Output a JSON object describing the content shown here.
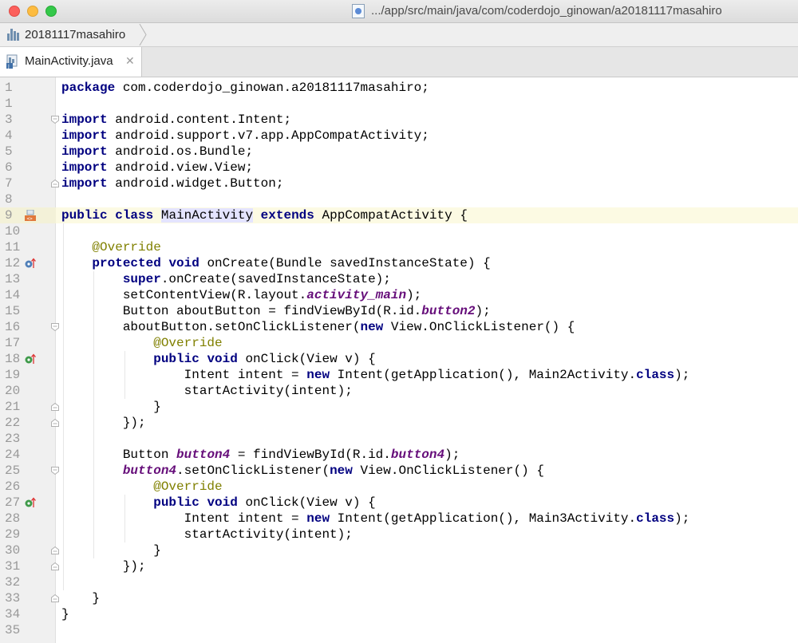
{
  "window": {
    "title_path": ".../app/src/main/java/com/coderdojo_ginowan/a20181117masahiro",
    "controls": {
      "close_color": "#fc605c",
      "minimize_color": "#fdbc40",
      "maximize_color": "#34c84a"
    }
  },
  "navbar": {
    "project": "20181117masahiro"
  },
  "tabs": [
    {
      "label": "MainActivity.java",
      "close": "✕",
      "active": true
    }
  ],
  "editor": {
    "highlight_line": 9,
    "colors": {
      "keyword": "#000080",
      "annotation": "#808000",
      "static_field": "#660e7a",
      "highlight": "#fcfae3"
    },
    "lines": [
      {
        "n": "1",
        "code": "package com.coderdojo_ginowan.a20181117masahiro;"
      },
      {
        "n": "1",
        "code": ""
      },
      {
        "n": "3",
        "code": "import android.content.Intent;"
      },
      {
        "n": "4",
        "code": "import android.support.v7.app.AppCompatActivity;"
      },
      {
        "n": "5",
        "code": "import android.os.Bundle;"
      },
      {
        "n": "6",
        "code": "import android.view.View;"
      },
      {
        "n": "7",
        "code": "import android.widget.Button;"
      },
      {
        "n": "8",
        "code": ""
      },
      {
        "n": "9",
        "code": "public class MainActivity extends AppCompatActivity {"
      },
      {
        "n": "10",
        "code": ""
      },
      {
        "n": "11",
        "code": "    @Override"
      },
      {
        "n": "12",
        "code": "    protected void onCreate(Bundle savedInstanceState) {"
      },
      {
        "n": "13",
        "code": "        super.onCreate(savedInstanceState);"
      },
      {
        "n": "14",
        "code": "        setContentView(R.layout.activity_main);"
      },
      {
        "n": "15",
        "code": "        Button aboutButton = findViewById(R.id.button2);"
      },
      {
        "n": "16",
        "code": "        aboutButton.setOnClickListener(new View.OnClickListener() {"
      },
      {
        "n": "17",
        "code": "            @Override"
      },
      {
        "n": "18",
        "code": "            public void onClick(View v) {"
      },
      {
        "n": "19",
        "code": "                Intent intent = new Intent(getApplication(), Main2Activity.class);"
      },
      {
        "n": "20",
        "code": "                startActivity(intent);"
      },
      {
        "n": "21",
        "code": "            }"
      },
      {
        "n": "22",
        "code": "        });"
      },
      {
        "n": "23",
        "code": ""
      },
      {
        "n": "24",
        "code": "        Button button4 = findViewById(R.id.button4);"
      },
      {
        "n": "25",
        "code": "        button4.setOnClickListener(new View.OnClickListener() {"
      },
      {
        "n": "26",
        "code": "            @Override"
      },
      {
        "n": "27",
        "code": "            public void onClick(View v) {"
      },
      {
        "n": "28",
        "code": "                Intent intent = new Intent(getApplication(), Main3Activity.class);"
      },
      {
        "n": "29",
        "code": "                startActivity(intent);"
      },
      {
        "n": "30",
        "code": "            }"
      },
      {
        "n": "31",
        "code": "        });"
      },
      {
        "n": "32",
        "code": ""
      },
      {
        "n": "33",
        "code": "    }"
      },
      {
        "n": "34",
        "code": "}"
      },
      {
        "n": "35",
        "code": ""
      }
    ]
  }
}
